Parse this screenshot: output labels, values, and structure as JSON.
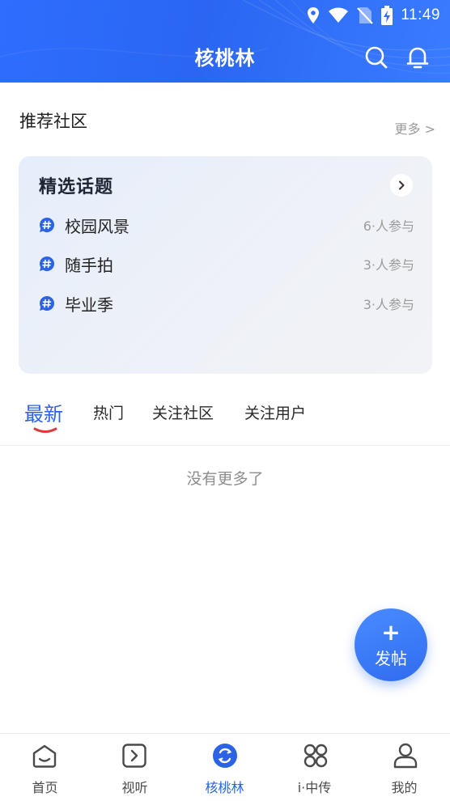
{
  "status_bar": {
    "time": "11:49",
    "icons": [
      "location-icon",
      "wifi-icon",
      "no-sim-icon",
      "battery-charging-icon"
    ]
  },
  "header": {
    "title": "核桃林",
    "icons": [
      "search-icon",
      "bell-icon"
    ]
  },
  "recommended": {
    "title": "推荐社区",
    "more_label": "更多 >"
  },
  "featured_topics": {
    "title": "精选话题",
    "items": [
      {
        "name": "校园风景",
        "participants": "6·人参与"
      },
      {
        "name": "随手拍",
        "participants": "3·人参与"
      },
      {
        "name": "毕业季",
        "participants": "3·人参与"
      }
    ]
  },
  "tabs": [
    {
      "label": "最新",
      "active": true
    },
    {
      "label": "热门",
      "active": false
    },
    {
      "label": "关注社区",
      "active": false
    },
    {
      "label": "关注用户",
      "active": false
    }
  ],
  "feed": {
    "empty_message": "没有更多了"
  },
  "fab": {
    "symbol": "+",
    "label": "发帖"
  },
  "bottom_nav": [
    {
      "label": "首页",
      "icon": "home-icon",
      "active": false
    },
    {
      "label": "视听",
      "icon": "play-icon",
      "active": false
    },
    {
      "label": "核桃林",
      "icon": "walnut-icon",
      "active": true
    },
    {
      "label": "i·中传",
      "icon": "apps-icon",
      "active": false
    },
    {
      "label": "我的",
      "icon": "profile-icon",
      "active": false
    }
  ],
  "colors": {
    "primary": "#2c63e6",
    "header_bg": "#2f6dff",
    "tab_underline": "#e23a3a",
    "card_bg": "#eaeff8",
    "muted_text": "#9c9c9c"
  }
}
